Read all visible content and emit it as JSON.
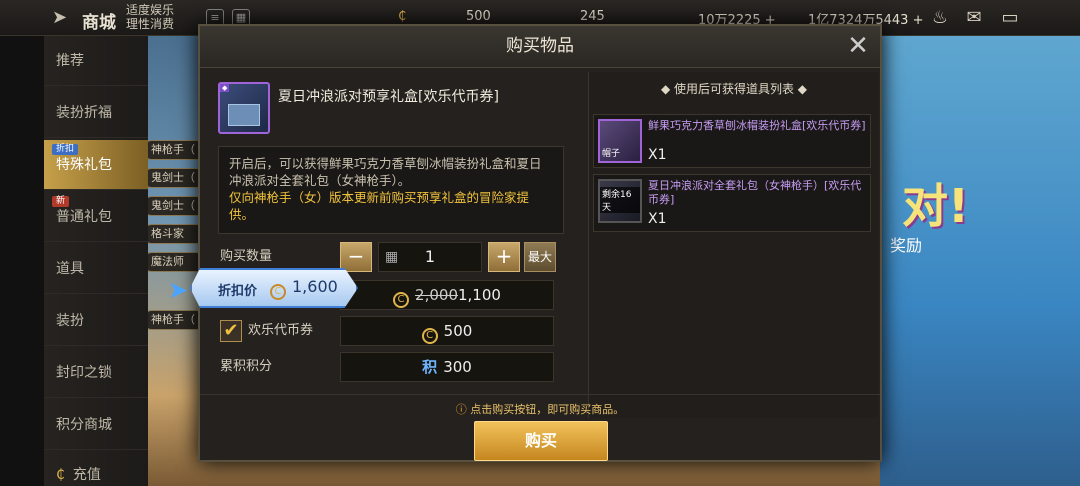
{
  "topbar": {
    "back_icon": "back-arrow-icon",
    "title": "商城",
    "warning_line1": "适度娱乐",
    "warning_line2": "理性消费",
    "currency1": "500",
    "currency2": "245",
    "currency3": "10万2225 +",
    "currency4": "1亿7324万5443 +"
  },
  "sidebar": {
    "items": [
      {
        "label": "推荐",
        "tag": ""
      },
      {
        "label": "装扮折福",
        "tag": ""
      },
      {
        "label": "特殊礼包",
        "tag": "折扣"
      },
      {
        "label": "普通礼包",
        "tag": "新"
      },
      {
        "label": "道具",
        "tag": ""
      },
      {
        "label": "装扮",
        "tag": ""
      },
      {
        "label": "封印之锁",
        "tag": ""
      },
      {
        "label": "积分商城",
        "tag": ""
      },
      {
        "label": "充值",
        "tag": ""
      }
    ]
  },
  "bg_chips": [
    "神枪手（",
    "鬼剑士（",
    "鬼剑士（",
    "格斗家",
    "魔法师",
    "神枪手（"
  ],
  "bg_text": {
    "big": "对!",
    "sub": "奖励"
  },
  "modal": {
    "title": "购买物品",
    "item_name": "夏日冲浪派对预享礼盒[欢乐代币券]",
    "desc_normal": "开启后，可以获得鲜果巧克力香草刨冰帽装扮礼盒和夏日冲浪派对全套礼包（女神枪手）。",
    "desc_highlight": "仅向神枪手（女）版本更新前购买预享礼盒的冒险家提供。",
    "qty_label": "购买数量",
    "qty_value": "1",
    "max_label": "最大",
    "discount_label": "折扣价",
    "discount_value": "1,600",
    "original_price": "2,000",
    "final_price": "1,100",
    "coupon_label": "欢乐代币券",
    "coupon_value": "500",
    "points_label": "累积积分",
    "points_icon": "积",
    "points_value": "300",
    "right_title": "◆ 使用后可获得道具列表 ◆",
    "gifts": [
      {
        "name": "鲜果巧克力香草刨冰帽装扮礼盒[欢乐代币券]",
        "qty": "X1",
        "icon_label": "帽子",
        "tag": ""
      },
      {
        "name": "夏日冲浪派对全套礼包（女神枪手）[欢乐代币券]",
        "qty": "X1",
        "icon_label": "",
        "tag": "剩余16天"
      }
    ],
    "tip": "点击购买按钮，即可购买商品。",
    "buy_label": "购买"
  }
}
